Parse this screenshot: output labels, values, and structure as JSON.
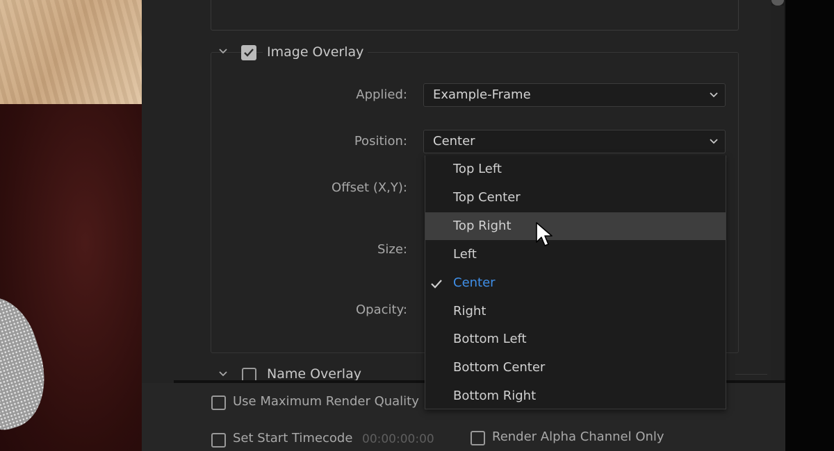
{
  "image_overlay": {
    "title": "Image Overlay",
    "checked": true,
    "fields": {
      "applied_label": "Applied:",
      "applied_value": "Example-Frame",
      "position_label": "Position:",
      "position_value": "Center",
      "offset_label": "Offset (X,Y):",
      "size_label": "Size:",
      "opacity_label": "Opacity:"
    }
  },
  "position_menu": {
    "items": [
      {
        "label": "Top Left"
      },
      {
        "label": "Top Center"
      },
      {
        "label": "Top Right"
      },
      {
        "label": "Left"
      },
      {
        "label": "Center"
      },
      {
        "label": "Right"
      },
      {
        "label": "Bottom Left"
      },
      {
        "label": "Bottom Center"
      },
      {
        "label": "Bottom Right"
      }
    ],
    "hovered": "Top Right",
    "selected": "Center"
  },
  "name_overlay": {
    "title": "Name Overlay",
    "checked": false
  },
  "render_options": {
    "max_quality_label": "Use Maximum Render Quality",
    "start_timecode_label": "Set Start Timecode",
    "start_timecode_value": "00:00:00:00",
    "alpha_only_label": "Render Alpha Channel Only"
  },
  "colors": {
    "panel_bg": "#232323",
    "menu_bg": "#1c1c1c",
    "hover_bg": "#3e3e3e",
    "selected_text": "#3f8fe8"
  }
}
